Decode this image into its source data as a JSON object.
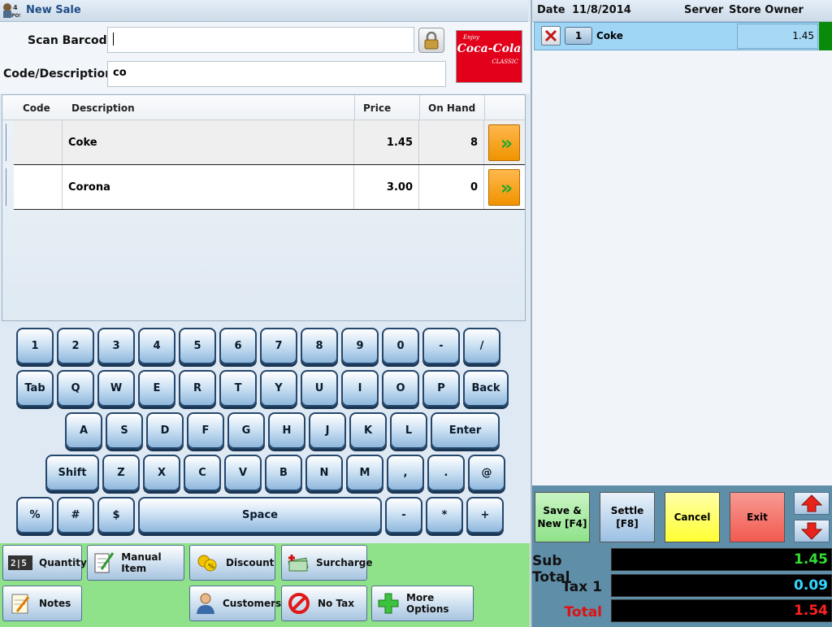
{
  "window": {
    "title": "New Sale",
    "app_icon_text": "4POS"
  },
  "form": {
    "scan_label": "Scan Barcode",
    "scan_value": "",
    "code_label": "Code/Description",
    "code_value": "co",
    "logo_top": "Enjoy",
    "logo_main": "Coca-Cola",
    "logo_sub": "CLASSIC"
  },
  "grid": {
    "headers": {
      "code": "Code",
      "description": "Description",
      "price": "Price",
      "onhand": "On Hand"
    },
    "rows": [
      {
        "code": "",
        "description": "Coke",
        "price": "1.45",
        "onhand": "8"
      },
      {
        "code": "",
        "description": "Corona",
        "price": "3.00",
        "onhand": "0"
      }
    ]
  },
  "keyboard": {
    "row1": [
      "1",
      "2",
      "3",
      "4",
      "5",
      "6",
      "7",
      "8",
      "9",
      "0",
      "-",
      "/"
    ],
    "row2": [
      "Tab",
      "Q",
      "W",
      "E",
      "R",
      "T",
      "Y",
      "U",
      "I",
      "O",
      "P",
      "Back"
    ],
    "row3": [
      "A",
      "S",
      "D",
      "F",
      "G",
      "H",
      "J",
      "K",
      "L",
      "Enter"
    ],
    "row4": [
      "Shift",
      "Z",
      "X",
      "C",
      "V",
      "B",
      "N",
      "M",
      ",",
      ".",
      "@"
    ],
    "row5": [
      "%",
      "#",
      "$",
      "Space",
      "-",
      "*",
      "+"
    ]
  },
  "actions": {
    "quantity": "Quantity",
    "manual_item": "Manual Item",
    "discount": "Discount",
    "surcharge": "Surcharge",
    "notes": "Notes",
    "customers": "Customers",
    "no_tax": "No Tax",
    "more_options": "More Options"
  },
  "header": {
    "date_label": "Date",
    "date_value": "11/8/2014",
    "server_label": "Server",
    "server_value": "Store Owner"
  },
  "sale_lines": [
    {
      "qty": "1",
      "name": "Coke",
      "amount": "1.45"
    }
  ],
  "controls": {
    "save_new": "Save &",
    "save_new_2": "New [F4]",
    "settle": "Settle",
    "settle_2": "[F8]",
    "cancel": "Cancel",
    "exit": "Exit"
  },
  "totals": {
    "subtotal_label": "Sub Total",
    "subtotal_value": "1.45",
    "tax_label": "Tax 1",
    "tax_value": "0.09",
    "total_label": "Total",
    "total_value": "1.54"
  },
  "colors": {
    "subtotal": "#33dd33",
    "tax": "#33d6ff",
    "total": "#ff2020",
    "save_btn": "#8fe28a",
    "cancel_btn": "#ffff33",
    "exit_btn": "#f25a50"
  }
}
